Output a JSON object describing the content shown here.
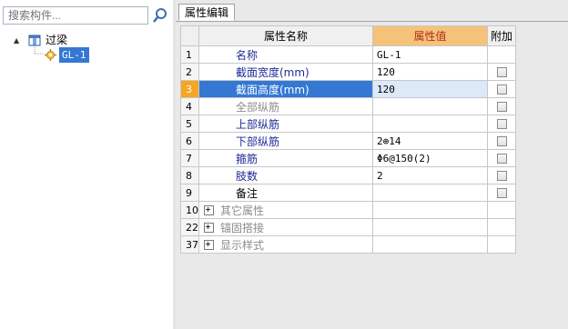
{
  "search": {
    "placeholder": "搜索构件..."
  },
  "tree": {
    "root": {
      "label": "过梁",
      "expander": "▲"
    },
    "child": {
      "label": "GL-1"
    }
  },
  "tab": {
    "label": "属性编辑"
  },
  "grid": {
    "headers": {
      "name": "属性名称",
      "value": "属性值",
      "extra": "附加"
    },
    "rows": [
      {
        "num": "1",
        "name": "名称",
        "value": "GL-1"
      },
      {
        "num": "2",
        "name": "截面宽度(mm)",
        "value": "120"
      },
      {
        "num": "3",
        "name": "截面高度(mm)",
        "value": "120"
      },
      {
        "num": "4",
        "name": "全部纵筋",
        "value": ""
      },
      {
        "num": "5",
        "name": "上部纵筋",
        "value": ""
      },
      {
        "num": "6",
        "name": "下部纵筋",
        "value": "2⊕14"
      },
      {
        "num": "7",
        "name": "箍筋",
        "value": "Φ6@150(2)"
      },
      {
        "num": "8",
        "name": "肢数",
        "value": "2"
      },
      {
        "num": "9",
        "name": "备注",
        "value": ""
      },
      {
        "num": "10",
        "name": "其它属性",
        "value": ""
      },
      {
        "num": "22",
        "name": "锚固搭接",
        "value": ""
      },
      {
        "num": "37",
        "name": "显示样式",
        "value": ""
      }
    ]
  },
  "colors": {
    "selection": "#3478d4",
    "row_marker": "#f5a623",
    "header_value_bg": "#f5c27a",
    "header_value_text": "#b42c1c",
    "link_text": "#1e2c96"
  }
}
